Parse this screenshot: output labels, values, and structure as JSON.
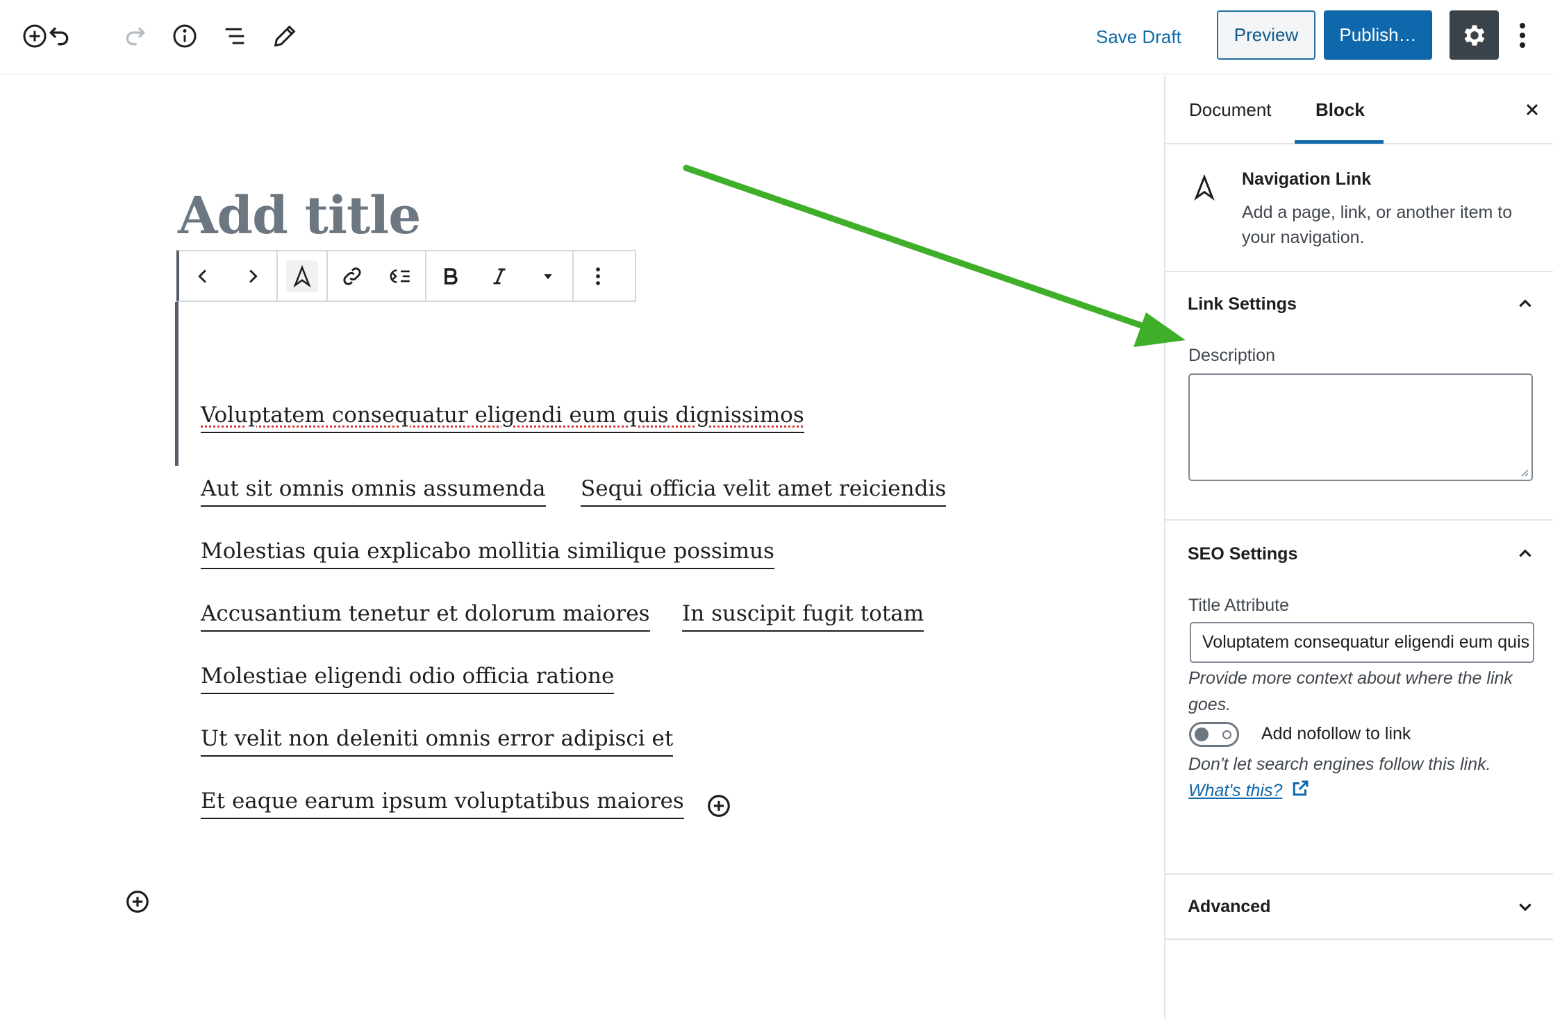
{
  "header": {
    "save_draft": "Save Draft",
    "preview": "Preview",
    "publish": "Publish…",
    "icons": [
      "add-block-icon",
      "undo-icon",
      "redo-icon",
      "info-icon",
      "list-view-icon",
      "tools-pencil-icon",
      "gear-icon",
      "more-vertical-icon"
    ]
  },
  "editor": {
    "title_placeholder": "Add title",
    "toolbar_icons": [
      "chevron-left-icon",
      "chevron-right-icon",
      "navigation-link-icon",
      "link-icon",
      "submenu-icon",
      "bold-icon",
      "italic-icon",
      "caret-down-icon",
      "more-vertical-icon"
    ],
    "selected_link": "Voluptatem consequatur eligendi eum quis dignissimos",
    "links": [
      "Aut sit omnis omnis assumenda",
      "Sequi officia velit amet reiciendis",
      "Molestias quia explicabo mollitia similique possimus",
      "Accusantium tenetur et dolorum maiores",
      "In suscipit fugit totam",
      "Molestiae eligendi odio officia ratione",
      "Ut velit non deleniti omnis error adipisci et",
      "Et eaque earum ipsum voluptatibus maiores"
    ],
    "annotation_arrow_color": "#3fae29"
  },
  "sidebar": {
    "tabs": [
      "Document",
      "Block"
    ],
    "active_tab": "Block",
    "block_card": {
      "title": "Navigation Link",
      "description": "Add a page, link, or another item to your navigation."
    },
    "link_settings": {
      "title": "Link Settings",
      "description_label": "Description",
      "description_value": ""
    },
    "seo_settings": {
      "title": "SEO Settings",
      "title_attribute_label": "Title Attribute",
      "title_attribute_value": "Voluptatem consequatur eligendi eum quis dignissimos",
      "title_attribute_help": "Provide more context about where the link goes.",
      "nofollow_label": "Add nofollow to link",
      "nofollow_enabled": false,
      "nofollow_help": "Don't let search engines follow this link.",
      "whats_this": "What's this?"
    },
    "advanced": {
      "title": "Advanced"
    }
  },
  "colors": {
    "accent": "#0f68ab",
    "settings_button": "#3b434a",
    "title_placeholder": "#6c7781"
  }
}
